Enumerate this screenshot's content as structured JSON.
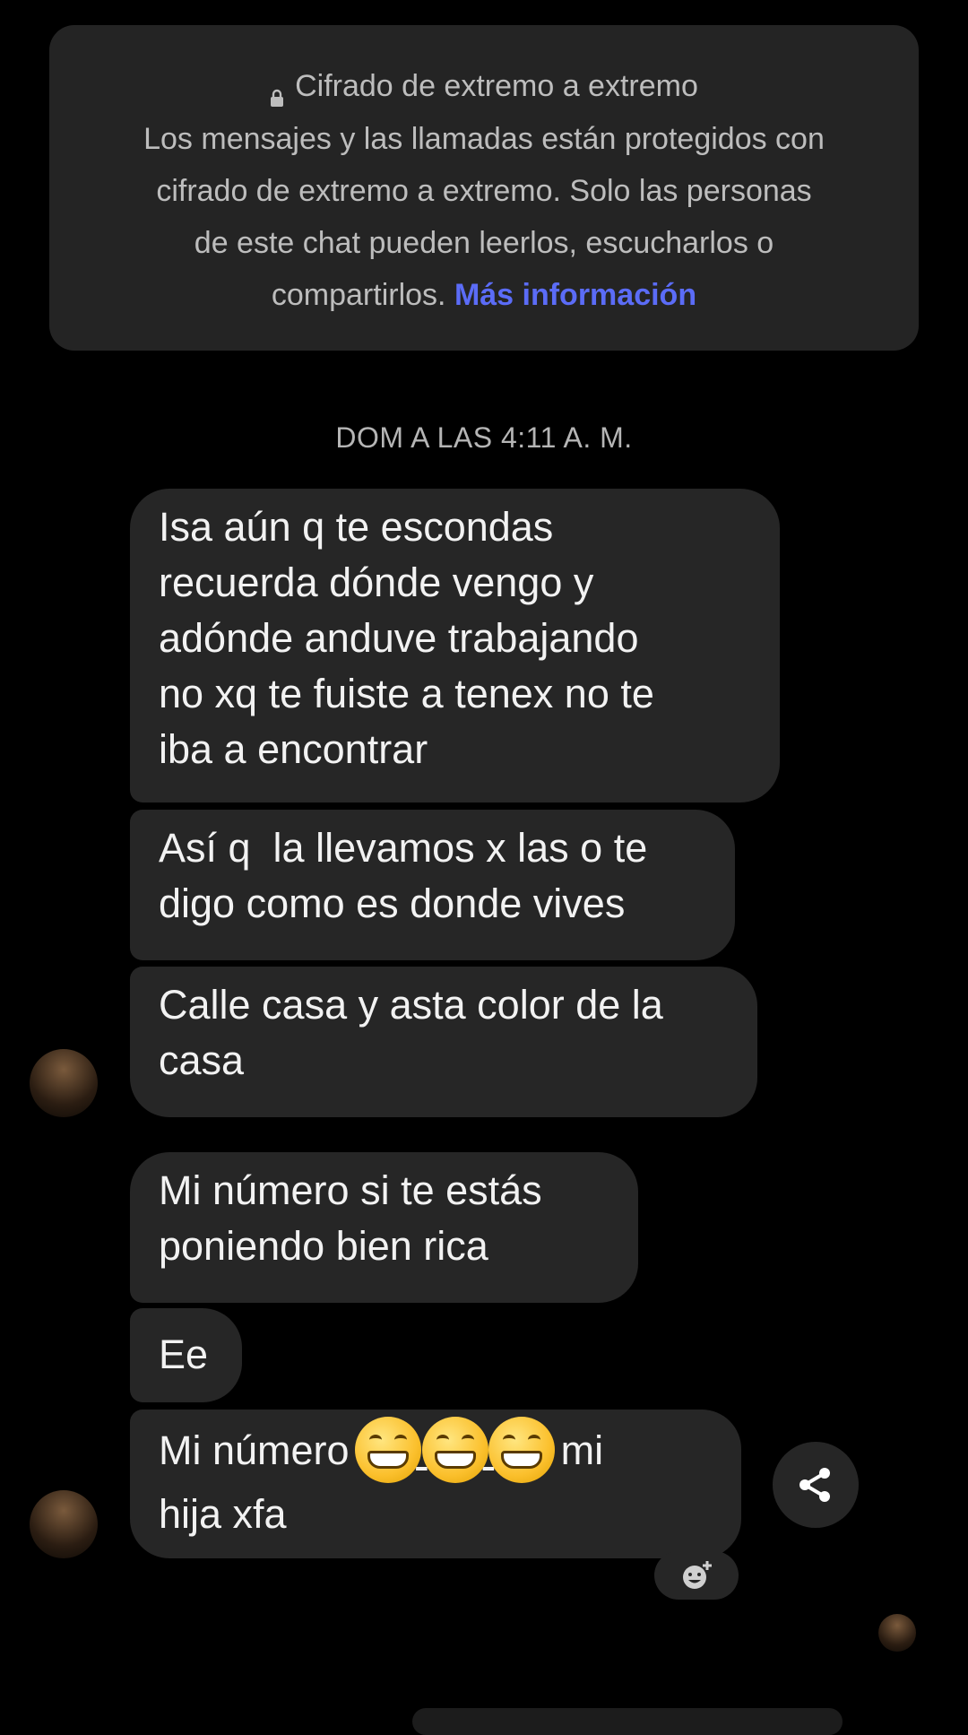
{
  "encryption_notice": {
    "title": "Cifrado de extremo a extremo",
    "line1": "Los mensajes y las llamadas están protegidos con",
    "line2": "cifrado de extremo a extremo. Solo las personas",
    "line3": "de este chat pueden leerlos, escucharlos o",
    "line4_text": "compartirlos.",
    "link": "Más información"
  },
  "timestamp": "DOM A LAS 4:11 A. M.",
  "messages": [
    {
      "lines": [
        "Isa aún q te escondas",
        "recuerda dónde vengo y",
        "adónde anduve trabajando",
        "no xq te fuiste a tenex no te",
        "iba a encontrar"
      ]
    },
    {
      "lines": [
        "Así q  la llevamos x las o te",
        "digo como es donde vives"
      ]
    },
    {
      "lines": [
        "Calle casa y asta color de la",
        "casa"
      ]
    },
    {
      "lines": [
        "Mi número si te estás",
        "poniendo bien rica"
      ]
    },
    {
      "lines": [
        "Ee"
      ]
    },
    {
      "line1_start": "Mi número",
      "line1_end": "mi",
      "line2": "hija xfa"
    }
  ],
  "icons": {
    "lock": "lock-icon",
    "share": "share-icon",
    "reaction": "add-reaction-icon",
    "emoji": "grinning-face-emoji"
  }
}
